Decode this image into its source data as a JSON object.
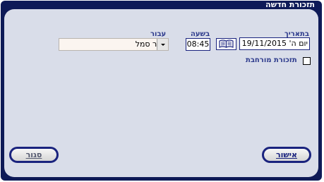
{
  "window": {
    "title": "תזכורת חדשה"
  },
  "form": {
    "date_label": "בתאריך",
    "date_value": "יום ה' 19/11/2015",
    "time_label": "בשעה",
    "time_value": "08:45",
    "for_label": "עבור",
    "for_selected": "יקיר סמל",
    "extended_label": "תזכורת מורחבת",
    "extended_checked": false
  },
  "buttons": {
    "ok_label": "אישור",
    "close_label": "סגור"
  },
  "colors": {
    "frame": "#0e1a57",
    "panel": "#d9dde9",
    "label": "#2d3a8c"
  },
  "icons": {
    "calendar": "open-book-icon",
    "dropdown": "chevron-down-icon"
  }
}
